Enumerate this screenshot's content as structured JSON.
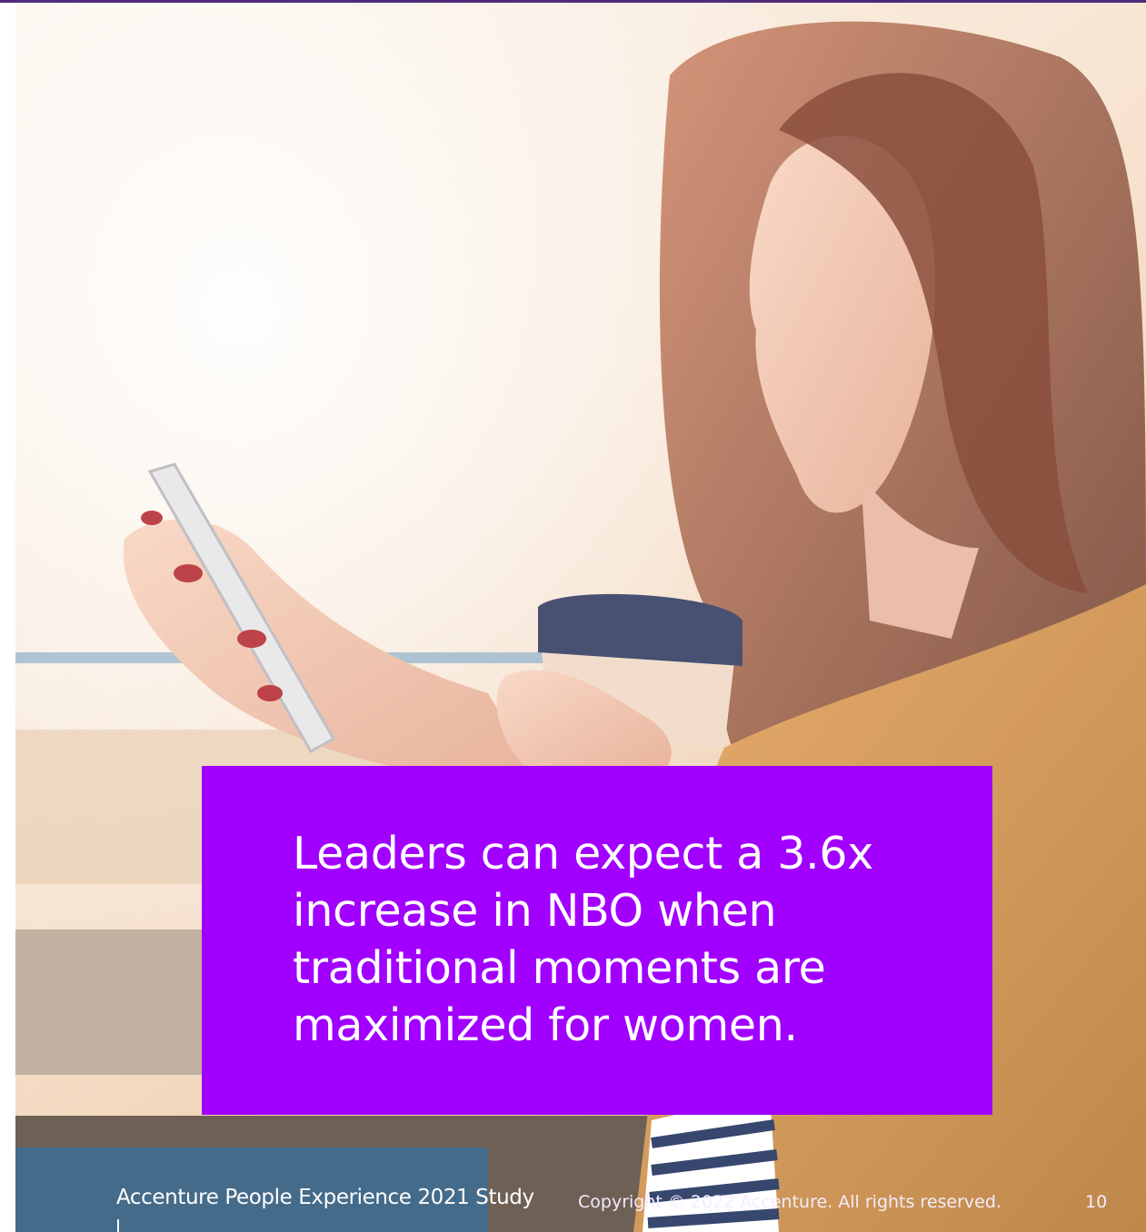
{
  "slide": {
    "headline": "Leaders can expect a 3.6x increase in NBO when traditional moments are maximized for women.",
    "accent_color": "#a100ff",
    "top_rule_color": "#4f2a7a"
  },
  "photo": {
    "subject": "woman holding smartphone and coffee cup by a sunlit window"
  },
  "footer": {
    "title": "Accenture People Experience 2021 Study",
    "copyright": "Copyright © 2022 Accenture. All rights reserved.",
    "page_number": "10"
  }
}
